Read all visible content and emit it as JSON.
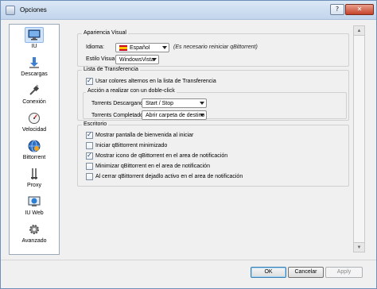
{
  "window": {
    "title": "Opciones",
    "help": "?",
    "close": "✕"
  },
  "sidebar": {
    "items": [
      {
        "label": "IU",
        "icon": "monitor-icon",
        "selected": true
      },
      {
        "label": "Descargas",
        "icon": "download-arrow-icon"
      },
      {
        "label": "Conexión",
        "icon": "connection-plug-icon"
      },
      {
        "label": "Velocidad",
        "icon": "speedometer-icon"
      },
      {
        "label": "Bittorrent",
        "icon": "bittorrent-globe-icon"
      },
      {
        "label": "Proxy",
        "icon": "proxy-icon"
      },
      {
        "label": "IU Web",
        "icon": "web-ui-icon"
      },
      {
        "label": "Avanzado",
        "icon": "gear-icon"
      }
    ]
  },
  "appearance": {
    "title": "Apariencia Visual",
    "language_label": "Idioma:",
    "language_value": "Español",
    "restart_note": "(Es necesario reiniciar qBittorrent)",
    "style_label": "Estilo Visual:",
    "style_value": "WindowsVista"
  },
  "transfer_list": {
    "title": "Lista de Transferencia",
    "alternate_colors_label": "Usar colores alternos en la lista de Transferencia",
    "alternate_colors_checked": true,
    "double_click_title": "Acción a realizar con un doble-click",
    "downloading_label": "Torrents Descargando:",
    "downloading_value": "Start / Stop",
    "completed_label": "Torrents Completados:",
    "completed_value": "Abrir carpeta de destino"
  },
  "desktop": {
    "title": "Escritorio",
    "options": [
      {
        "label": "Mostrar pantalla de bienvenida al iniciar",
        "checked": true
      },
      {
        "label": "Iniciar qBittorrent minimizado",
        "checked": false
      },
      {
        "label": "Mostrar icono de qBittorrent en el area de notificación",
        "checked": true
      },
      {
        "label": "Minimizar qBittorrent en el area de notificación",
        "checked": false
      },
      {
        "label": "Al cerrar qBittorrent dejadlo activo en el area de notificación",
        "checked": false
      }
    ]
  },
  "buttons": {
    "ok": "OK",
    "cancel": "Cancelar",
    "apply": "Apply"
  }
}
